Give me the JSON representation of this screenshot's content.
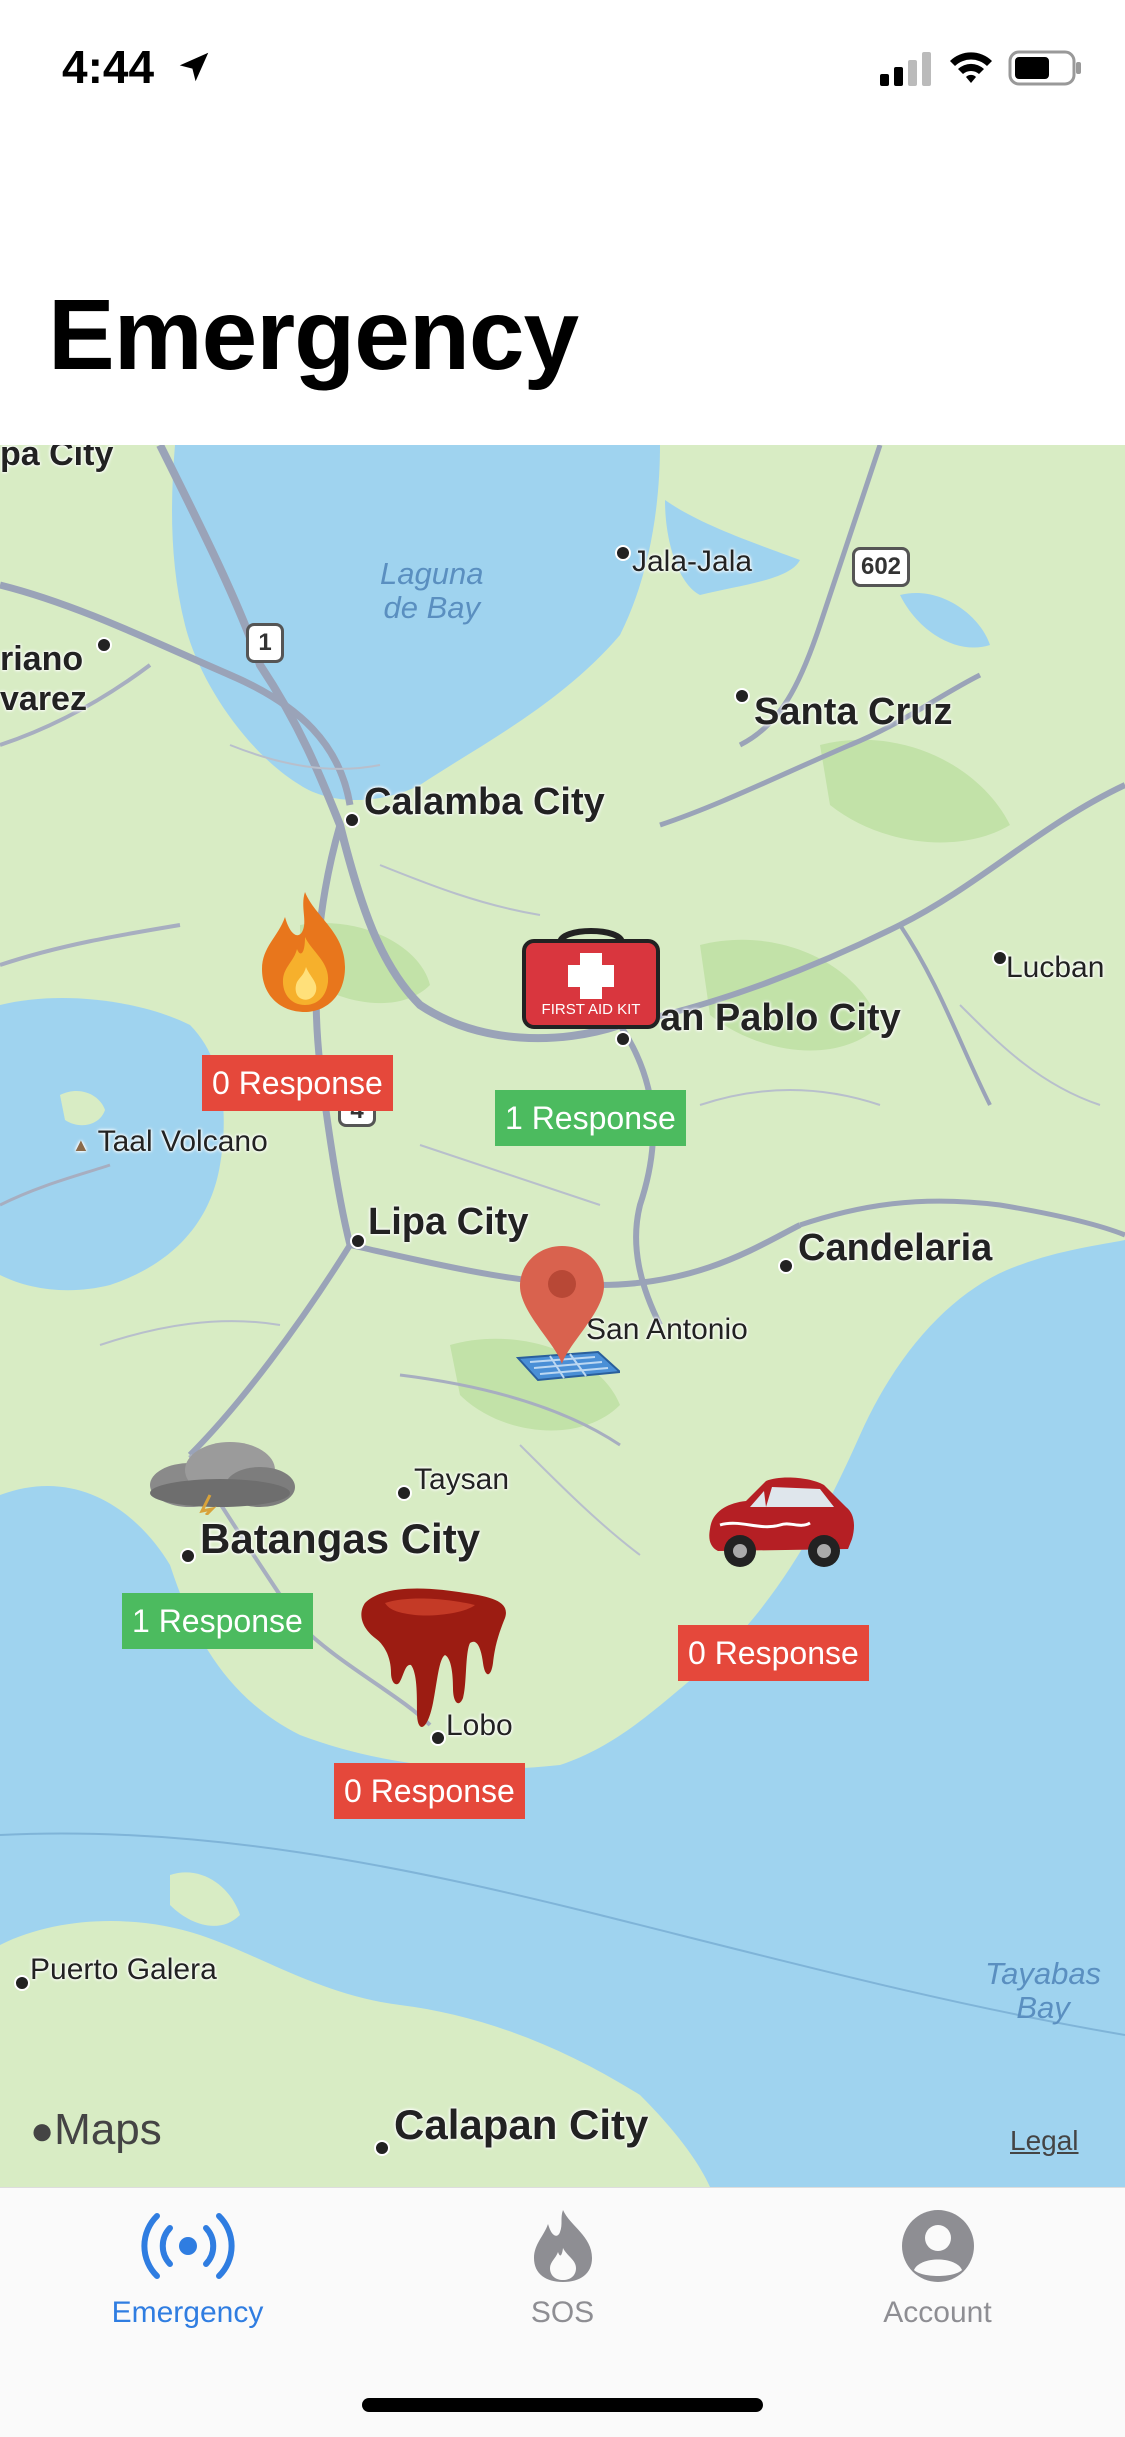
{
  "status_bar": {
    "time": "4:44"
  },
  "page": {
    "title": "Emergency"
  },
  "map": {
    "labels": {
      "lipa_city_top": "pa City",
      "laguna_de_bay": [
        "Laguna",
        "de Bay"
      ],
      "jala_jala": "Jala-Jala",
      "route_602": "602",
      "route_1": "1",
      "route_4": "4",
      "mariano": "riano",
      "alvarez": "varez",
      "santa_cruz": "Santa Cruz",
      "calamba_city": "Calamba City",
      "lucban": "Lucban",
      "san_pablo_city": "an Pablo City",
      "taal_volcano": "Taal Volcano",
      "lipa_city": "Lipa City",
      "candelaria": "Candelaria",
      "san_antonio": "San Antonio",
      "taysan": "Taysan",
      "batangas_city": "Batangas City",
      "lobo": "Lobo",
      "puerto_galera": "Puerto Galera",
      "tayabas_bay": [
        "Tayabas",
        "Bay"
      ],
      "calapan_city": "Calapan City"
    },
    "incidents": [
      {
        "type": "fire",
        "response": "0 Response",
        "status_color": "#e5483b"
      },
      {
        "type": "first-aid",
        "response": "1 Response",
        "status_color": "#4cbb5f",
        "icon_text": "FIRST AID KIT"
      },
      {
        "type": "storm",
        "response": "1 Response",
        "status_color": "#4cbb5f"
      },
      {
        "type": "blood",
        "response": "0 Response",
        "status_color": "#e5483b"
      },
      {
        "type": "car-crash",
        "response": "0 Response",
        "status_color": "#e5483b"
      }
    ],
    "attribution": {
      "logo": "Maps",
      "legal": "Legal"
    }
  },
  "tabbar": {
    "tabs": [
      {
        "label": "Emergency",
        "icon": "broadcast-icon",
        "active": true
      },
      {
        "label": "SOS",
        "icon": "flame-icon",
        "active": false
      },
      {
        "label": "Account",
        "icon": "person-circle-icon",
        "active": false
      }
    ],
    "active_color": "#2f7de1",
    "inactive_color": "#8e8e93"
  }
}
